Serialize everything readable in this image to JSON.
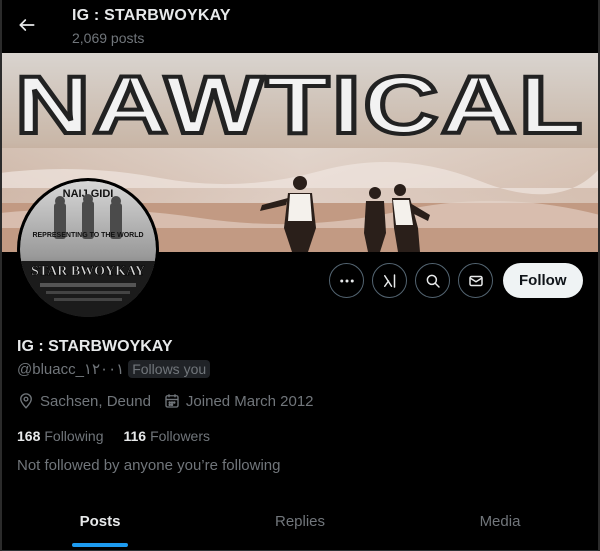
{
  "header": {
    "title": "IG : STARBWOYKAY",
    "posts_count": "2,069 posts"
  },
  "banner": {
    "text": "NAWTICAL"
  },
  "avatar": {
    "top_text": "NAIJ GIDI",
    "middle_text": "REPRESENTING TO THE WORLD",
    "name_text": "STAR BWOYKAY"
  },
  "actions": {
    "follow_label": "Follow"
  },
  "profile": {
    "name": "IG : STARBWOYKAY",
    "handle": "@bluacc_۱۲۰۰۱",
    "follows_you": "Follows you",
    "location": "Sachsen, Deund",
    "joined": "Joined March 2012",
    "following_count": "168",
    "following_label": "Following",
    "followers_count": "116",
    "followers_label": "Followers",
    "not_followed": "Not followed by anyone you’re following"
  },
  "tabs": [
    {
      "label": "Posts",
      "active": true
    },
    {
      "label": "Replies",
      "active": false
    },
    {
      "label": "Media",
      "active": false
    }
  ],
  "colors": {
    "background": "#000000",
    "accent": "#1d9bf0",
    "muted_text": "#71767b",
    "primary_text": "#e7e9ea"
  }
}
